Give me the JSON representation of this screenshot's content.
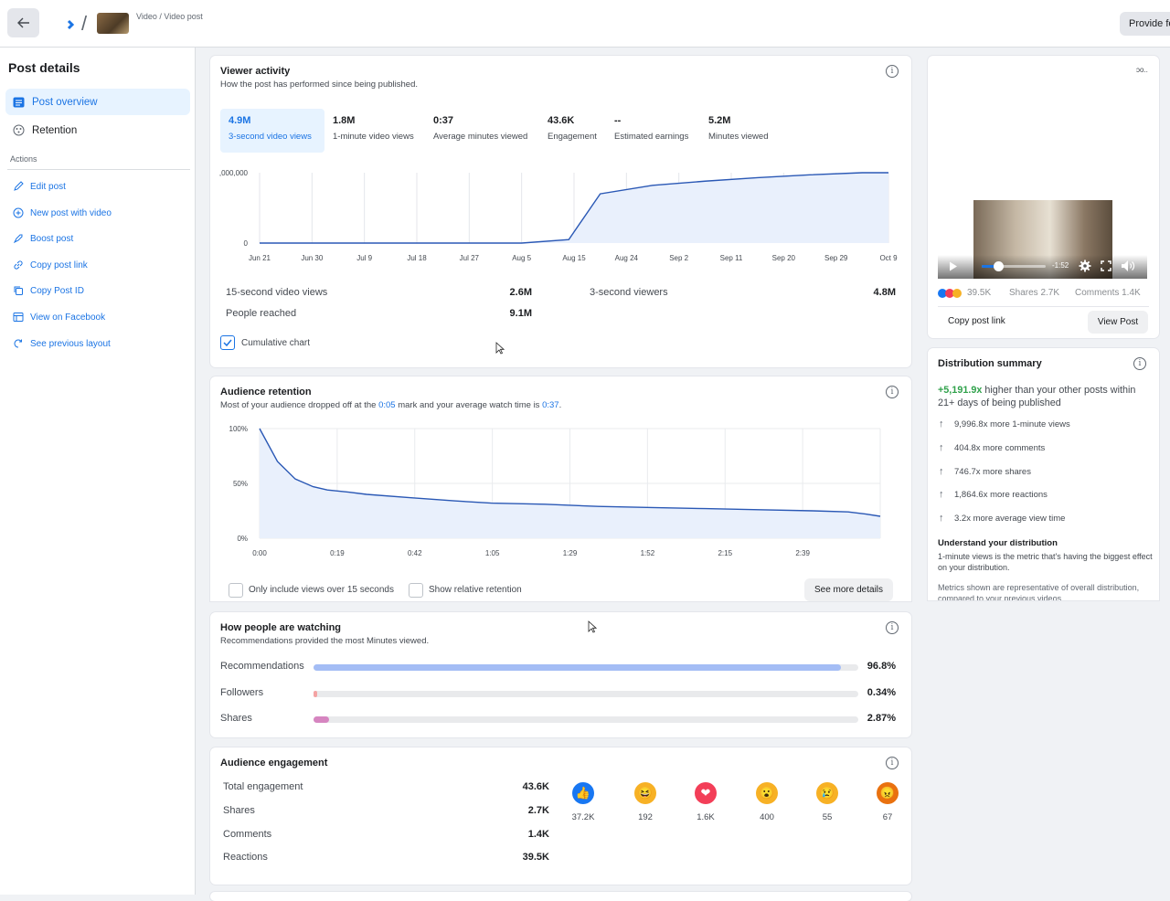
{
  "header": {
    "breadcrumb": "Video / Video post",
    "feedback_label": "Provide fe"
  },
  "sidebar": {
    "title": "Post details",
    "nav": [
      {
        "label": "Post overview",
        "icon": "post-overview-icon",
        "active": true
      },
      {
        "label": "Retention",
        "icon": "retention-icon",
        "active": false
      }
    ],
    "actions_label": "Actions",
    "actions": [
      {
        "label": "Edit post",
        "icon": "pencil-icon"
      },
      {
        "label": "New post with video",
        "icon": "plus-circle-icon"
      },
      {
        "label": "Boost post",
        "icon": "rocket-icon"
      },
      {
        "label": "Copy post link",
        "icon": "link-icon"
      },
      {
        "label": "Copy Post ID",
        "icon": "copy-icon"
      },
      {
        "label": "View on Facebook",
        "icon": "facebook-page-icon"
      },
      {
        "label": "See previous layout",
        "icon": "undo-icon"
      }
    ]
  },
  "viewer_activity": {
    "title": "Viewer activity",
    "subtitle": "How the post has performed since being published.",
    "metrics": [
      {
        "value": "4.9M",
        "label": "3-second video views"
      },
      {
        "value": "1.8M",
        "label": "1-minute video views"
      },
      {
        "value": "0:37",
        "label": "Average minutes viewed"
      },
      {
        "value": "43.6K",
        "label": "Engagement"
      },
      {
        "value": "--",
        "label": "Estimated earnings"
      },
      {
        "value": "5.2M",
        "label": "Minutes viewed"
      }
    ],
    "stats": [
      {
        "label": "15-second video views",
        "value": "2.6M"
      },
      {
        "label": "3-second viewers",
        "value": "4.8M"
      },
      {
        "label": "People reached",
        "value": "9.1M"
      }
    ],
    "checkbox_label": "Cumulative chart",
    "checkbox_checked": true
  },
  "audience_retention": {
    "title": "Audience retention",
    "subtitle_pre": "Most of your audience dropped off at the ",
    "subtitle_mark": "0:05",
    "subtitle_mid": " mark and your average watch time is ",
    "subtitle_avg": "0:37",
    "subtitle_end": ".",
    "check1": "Only include views over 15 seconds",
    "check2": "Show relative retention",
    "more_button": "See more details"
  },
  "how_watching": {
    "title": "How people are watching",
    "subtitle": "Recommendations provided the most Minutes viewed.",
    "rows": [
      {
        "label": "Recommendations",
        "value": "96.8%",
        "fraction": 0.968,
        "color": "#a4bdf5"
      },
      {
        "label": "Followers",
        "value": "0.34%",
        "fraction": 0.0034,
        "color": "#f4a3a3"
      },
      {
        "label": "Shares",
        "value": "2.87%",
        "fraction": 0.0287,
        "color": "#d685c0"
      }
    ]
  },
  "engagement": {
    "title": "Audience engagement",
    "rows": [
      {
        "label": "Total engagement",
        "value": "43.6K"
      },
      {
        "label": "Shares",
        "value": "2.7K"
      },
      {
        "label": "Comments",
        "value": "1.4K"
      },
      {
        "label": "Reactions",
        "value": "39.5K"
      }
    ],
    "reactions": [
      {
        "icon": "like-icon",
        "count": "37.2K",
        "color": "#1877f2"
      },
      {
        "icon": "haha-icon",
        "count": "192",
        "color": "#f7b125"
      },
      {
        "icon": "love-icon",
        "count": "1.6K",
        "color": "#f33e58"
      },
      {
        "icon": "wow-icon",
        "count": "400",
        "color": "#f7b125"
      },
      {
        "icon": "sad-icon",
        "count": "55",
        "color": "#f7b125"
      },
      {
        "icon": "angry-icon",
        "count": "67",
        "color": "#e9710f"
      }
    ]
  },
  "post_preview": {
    "corner_text": "ᴐo..",
    "time_remaining": "-1:52",
    "reactions_count": "39.5K",
    "shares": "Shares 2.7K",
    "comments": "Comments 1.4K",
    "copy_link": "Copy post link",
    "view_post": "View Post"
  },
  "distribution": {
    "title": "Distribution summary",
    "headline_value": "+5,191.9x",
    "headline_rest": " higher than your other posts within 21+ days of being published",
    "rows": [
      "9,996.8x more 1-minute views",
      "404.8x more comments",
      "746.7x more shares",
      "1,864.6x more reactions",
      "3.2x more average view time"
    ],
    "understand_title": "Understand your distribution",
    "understand_text": "1-minute views is the metric that's having the biggest effect on your distribution.",
    "footnote": "Metrics shown are representative of overall distribution, compared to your previous videos"
  },
  "chart_data": [
    {
      "type": "area",
      "title": "",
      "x_ticks": [
        "Jun 21",
        "Jun 30",
        "Jul 9",
        "Jul 18",
        "Jul 27",
        "Aug 5",
        "Aug 15",
        "Aug 24",
        "Sep 2",
        "Sep 11",
        "Sep 20",
        "Sep 29",
        "Oct 9"
      ],
      "y_ticks": [
        "0",
        ",000,000"
      ],
      "series": [
        {
          "values": [
            0,
            0,
            0,
            0,
            0,
            0,
            0.05,
            0.7,
            0.82,
            0.88,
            0.93,
            0.97,
            1.0,
            1.0
          ]
        }
      ],
      "x_index": [
        0,
        1,
        2,
        3,
        4,
        5,
        5.9,
        6.5,
        7.5,
        8.5,
        9.5,
        10.5,
        11.5,
        12
      ],
      "ylim": [
        0,
        1
      ]
    },
    {
      "type": "area",
      "title": "",
      "x_ticks": [
        "0:00",
        "0:19",
        "0:42",
        "1:05",
        "1:29",
        "1:52",
        "2:15",
        "2:39"
      ],
      "y_ticks": [
        "0%",
        "50%",
        "100%"
      ],
      "x": [
        0,
        5,
        10,
        15,
        19,
        25,
        30,
        42,
        55,
        65,
        80,
        95,
        110,
        125,
        140,
        155,
        165,
        170,
        174
      ],
      "series": [
        {
          "values": [
            100,
            70,
            54,
            47,
            44,
            42,
            40,
            37,
            34,
            32,
            31,
            29,
            28,
            27,
            26,
            25,
            24,
            22,
            20
          ]
        }
      ],
      "ylim": [
        0,
        100
      ]
    }
  ]
}
